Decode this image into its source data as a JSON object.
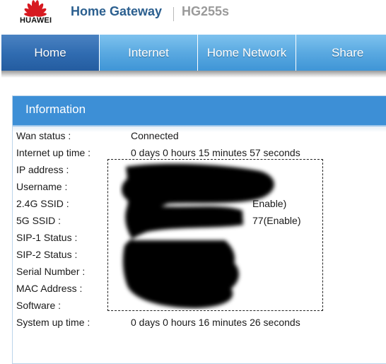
{
  "header": {
    "brand": "HUAWEI",
    "title": "Home Gateway",
    "model": "HG255s"
  },
  "nav": {
    "tabs": [
      {
        "label": "Home"
      },
      {
        "label": "Internet"
      },
      {
        "label": "Home Network"
      },
      {
        "label": "Share"
      }
    ]
  },
  "info": {
    "title": "Information",
    "rows": [
      {
        "label": "Wan status :",
        "value": "Connected"
      },
      {
        "label": "Internet up time :",
        "value": "0 days 0 hours 15 minutes 57 seconds"
      },
      {
        "label": "IP address :",
        "value": ""
      },
      {
        "label": "Username :",
        "value": ""
      },
      {
        "label": "2.4G SSID :",
        "value": "Enable)"
      },
      {
        "label": "5G SSID :",
        "value": "77(Enable)"
      },
      {
        "label": "SIP-1 Status :",
        "value": ""
      },
      {
        "label": "SIP-2 Status :",
        "value": ""
      },
      {
        "label": "Serial Number :",
        "value": ""
      },
      {
        "label": "MAC Address :",
        "value": ""
      },
      {
        "label": "Software :",
        "value": ""
      },
      {
        "label": "System up time :",
        "value": "0 days 0 hours 16 minutes 26 seconds"
      }
    ]
  },
  "colors": {
    "title": "#2b5f8f",
    "tab_active": "#2f6bb0",
    "tab_inactive": "#5aa9e1",
    "panel_header": "#3d8fd6"
  }
}
